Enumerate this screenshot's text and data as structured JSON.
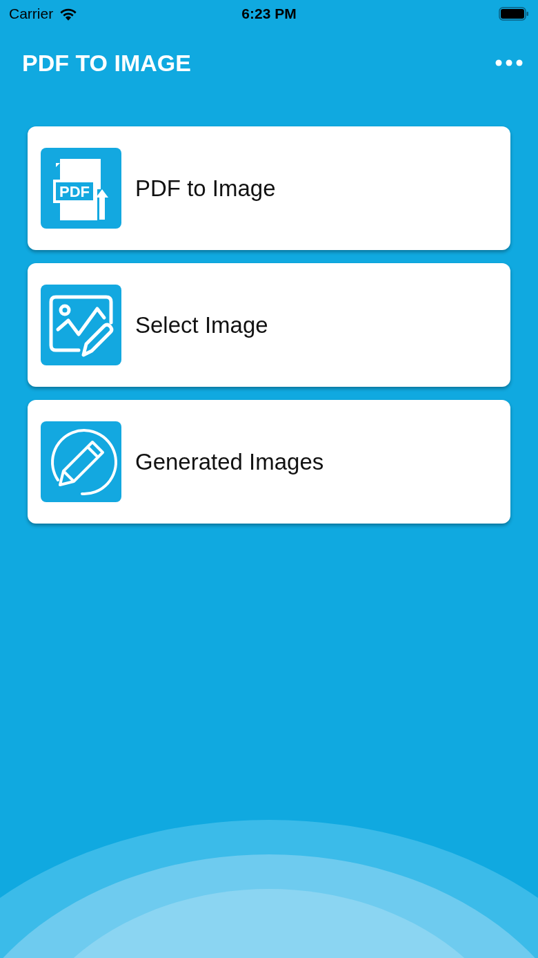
{
  "status_bar": {
    "carrier": "Carrier",
    "time": "6:23 PM"
  },
  "app_bar": {
    "title": "PDF TO IMAGE"
  },
  "items": [
    {
      "kind": "pdf",
      "label": "PDF to Image",
      "icon_text": "PDF"
    },
    {
      "kind": "image",
      "label": "Select Image"
    },
    {
      "kind": "pencil",
      "label": "Generated Images"
    }
  ]
}
